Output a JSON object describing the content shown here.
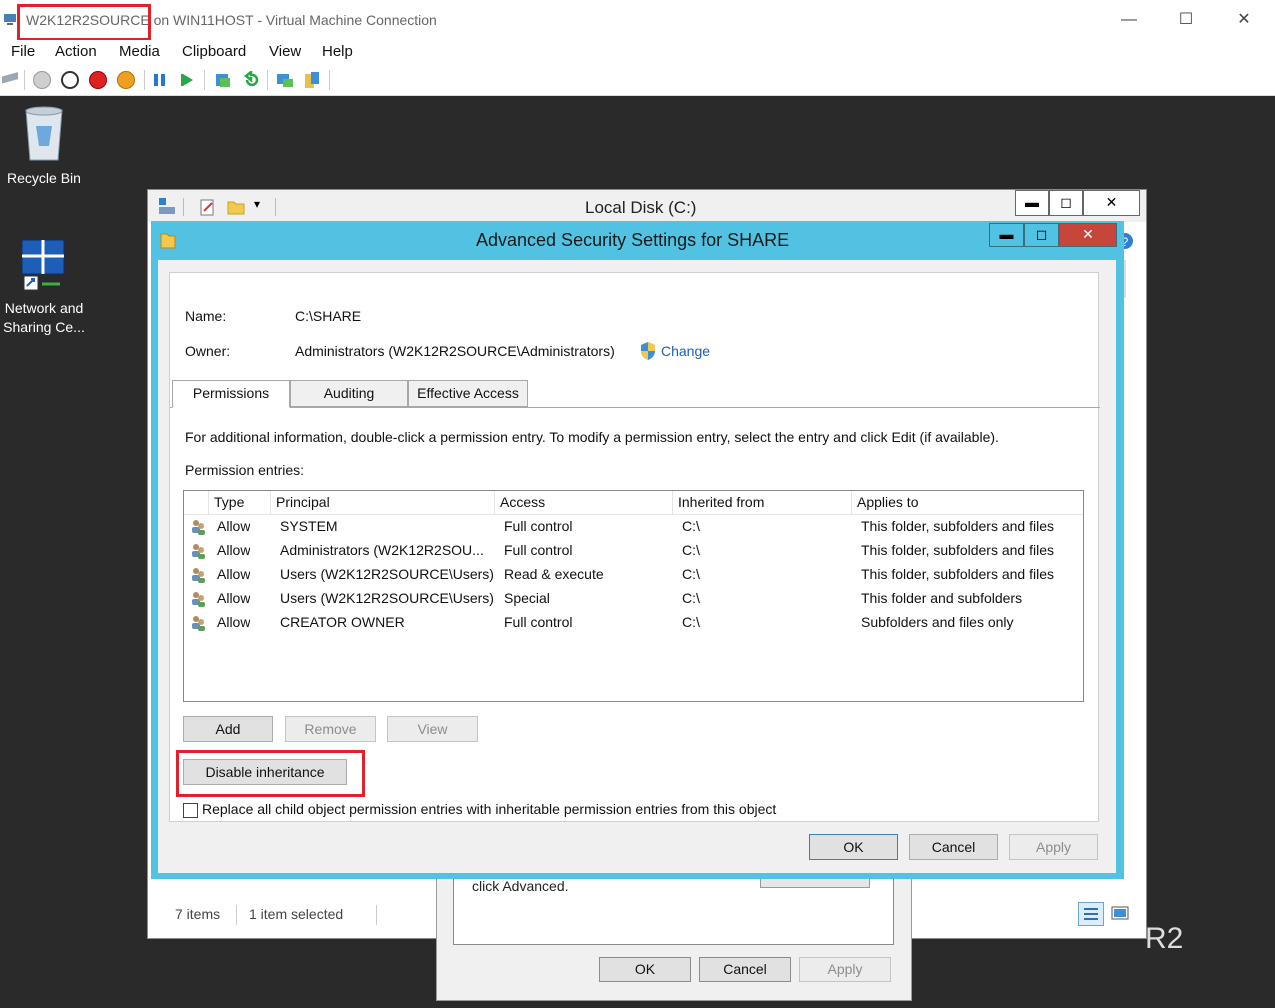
{
  "host": {
    "title_vm": "W2K12R2SOURCE",
    "title_rest": " on WIN11HOST - Virtual Machine Connection",
    "window_controls": {
      "minimize": "—",
      "maximize": "☐",
      "close": "✕"
    },
    "menu": [
      "File",
      "Action",
      "Media",
      "Clipboard",
      "View",
      "Help"
    ]
  },
  "desktop": {
    "recycle_bin": "Recycle Bin",
    "network_line1": "Network and",
    "network_line2": "Sharing Ce...",
    "watermark": "R2"
  },
  "explorer": {
    "title": "Local Disk (C:)",
    "status_items": "7 items",
    "status_selected": "1 item selected",
    "controls": {
      "minimize": "▬",
      "maximize": "◻",
      "close": "✕"
    }
  },
  "props_dialog": {
    "text": "click Advanced.",
    "ok": "OK",
    "cancel": "Cancel",
    "apply": "Apply"
  },
  "adv": {
    "title": "Advanced Security Settings for SHARE",
    "controls": {
      "minimize": "▬",
      "maximize": "◻",
      "close": "✕"
    },
    "name_label": "Name:",
    "name_value": "C:\\SHARE",
    "owner_label": "Owner:",
    "owner_value": "Administrators (W2K12R2SOURCE\\Administrators)",
    "change_link": "Change",
    "tabs": [
      "Permissions",
      "Auditing",
      "Effective Access"
    ],
    "info_text": "For additional information, double-click a permission entry. To modify a permission entry, select the entry and click Edit (if available).",
    "entries_label": "Permission entries:",
    "columns": [
      "Type",
      "Principal",
      "Access",
      "Inherited from",
      "Applies to"
    ],
    "rows": [
      {
        "type": "Allow",
        "principal": "SYSTEM",
        "access": "Full control",
        "inherited": "C:\\",
        "applies": "This folder, subfolders and files"
      },
      {
        "type": "Allow",
        "principal": "Administrators (W2K12R2SOU...",
        "access": "Full control",
        "inherited": "C:\\",
        "applies": "This folder, subfolders and files"
      },
      {
        "type": "Allow",
        "principal": "Users (W2K12R2SOURCE\\Users)",
        "access": "Read & execute",
        "inherited": "C:\\",
        "applies": "This folder, subfolders and files"
      },
      {
        "type": "Allow",
        "principal": "Users (W2K12R2SOURCE\\Users)",
        "access": "Special",
        "inherited": "C:\\",
        "applies": "This folder and subfolders"
      },
      {
        "type": "Allow",
        "principal": "CREATOR OWNER",
        "access": "Full control",
        "inherited": "C:\\",
        "applies": "Subfolders and files only"
      }
    ],
    "add": "Add",
    "remove": "Remove",
    "view": "View",
    "disable_inheritance": "Disable inheritance",
    "replace_checkbox": "Replace all child object permission entries with inheritable permission entries from this object",
    "ok": "OK",
    "cancel": "Cancel",
    "apply": "Apply"
  },
  "colors": {
    "dialog_frame": "#51c2e2",
    "highlight": "#e0202a",
    "close_button": "#c7463c",
    "link": "#1a5fb4"
  }
}
